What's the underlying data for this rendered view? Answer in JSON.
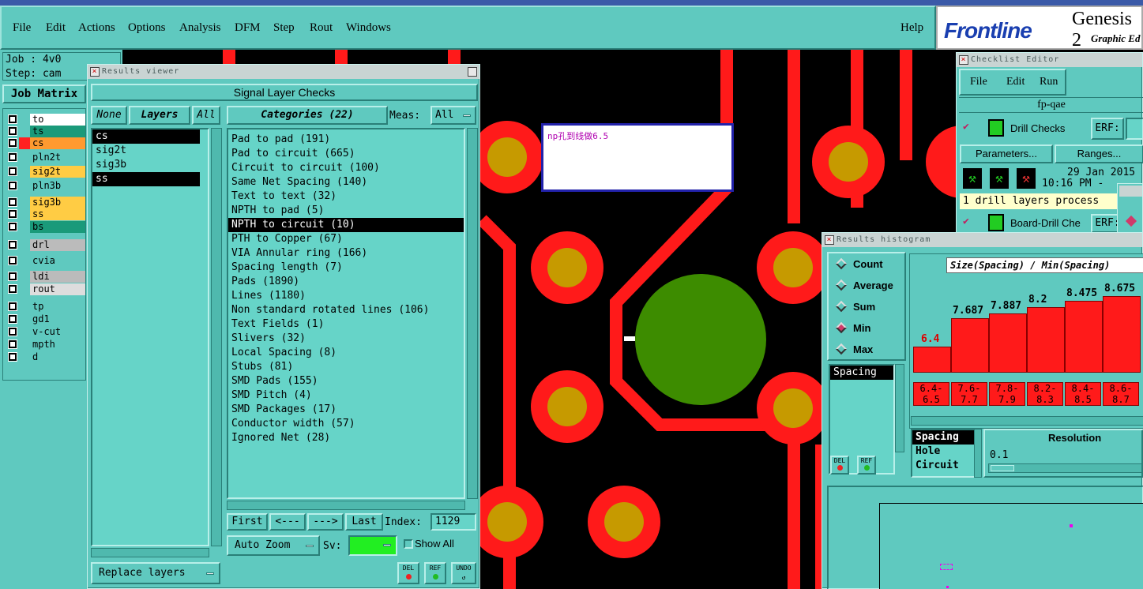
{
  "menu": {
    "file": "File",
    "edit": "Edit",
    "actions": "Actions",
    "options": "Options",
    "analysis": "Analysis",
    "dfm": "DFM",
    "step": "Step",
    "rout": "Rout",
    "windows": "Windows",
    "help": "Help"
  },
  "logo": {
    "brand": "Frontline",
    "product": "Genesis 2",
    "subtitle": "Graphic Ed"
  },
  "job": {
    "job_label": "Job : 4v0",
    "step_label": "Step: cam",
    "matrix_button": "Job Matrix"
  },
  "layers": [
    {
      "name": "to",
      "color": "#ffffff"
    },
    {
      "name": "ts",
      "color": "#1a9a7a"
    },
    {
      "name": "cs",
      "color": "#ff9a30"
    },
    {
      "name": "pln2t",
      "color": "#5fc9bf"
    },
    {
      "name": "sig2t",
      "color": "#ffcc44"
    },
    {
      "name": "pln3b",
      "color": "#5fc9bf"
    },
    {
      "name": "sig3b",
      "color": "#ffcc44"
    },
    {
      "name": "ss",
      "color": "#ffcc44"
    },
    {
      "name": "bs",
      "color": "#1a9a7a"
    },
    {
      "name": "drl",
      "color": "#bbbbbb"
    },
    {
      "name": "cvia",
      "color": "#5fc9bf"
    },
    {
      "name": "ldi",
      "color": "#bbbbbb"
    },
    {
      "name": "rout",
      "color": "#dddddd"
    },
    {
      "name": "tp",
      "color": "#5fc9bf"
    },
    {
      "name": "gd1",
      "color": "#5fc9bf"
    },
    {
      "name": "v-cut",
      "color": "#5fc9bf"
    },
    {
      "name": "mpth",
      "color": "#5fc9bf"
    },
    {
      "name": "d",
      "color": "#5fc9bf"
    }
  ],
  "results_viewer": {
    "title": "Results viewer",
    "header": "Signal Layer Checks",
    "none_btn": "None",
    "layers_btn": "Layers",
    "all_btn": "All",
    "layer_list": [
      "cs",
      "sig2t",
      "sig3b",
      "ss"
    ],
    "categories_btn": "Categories (22)",
    "meas_label": "Meas:",
    "meas_value": "All",
    "categories": [
      "Pad to pad (191)",
      "Pad to circuit (665)",
      "Circuit to circuit (100)",
      "Same Net Spacing (140)",
      "Text to text (32)",
      "NPTH to pad (5)",
      "NPTH to circuit (10)",
      "PTH to Copper (67)",
      "VIA Annular ring (166)",
      "Spacing length (7)",
      "Pads (1890)",
      "Lines (1180)",
      "Non standard rotated lines (106)",
      "Text Fields (1)",
      "Slivers (32)",
      "Local Spacing (8)",
      "Stubs (81)",
      "SMD Pads (155)",
      "SMD Pitch (4)",
      "SMD Packages (17)",
      "Conductor width (57)",
      "Ignored Net (28)"
    ],
    "first": "First",
    "prev": "<---",
    "next": "--->",
    "last": "Last",
    "index_label": "Index:",
    "index_value": "1129",
    "auto_zoom": "Auto Zoom",
    "sv_label": "Sv:",
    "show_all": "Show All",
    "replace_layers": "Replace layers",
    "del": "DEL",
    "ref": "REF",
    "undo": "UNDO"
  },
  "annotation": "np孔到线做6.5",
  "checklist": {
    "title": "Checklist Editor",
    "file": "File",
    "edit": "Edit",
    "run": "Run",
    "name": "fp-qae",
    "drill_checks": "Drill Checks",
    "erf": "ERF:",
    "params": "Parameters...",
    "ranges": "Ranges...",
    "date": "29 Jan 2015",
    "time": "10:16 PM -",
    "status": "1 drill layers process",
    "board_drill": "Board-Drill Che"
  },
  "histogram": {
    "title": "Results histogram",
    "radios": [
      "Count",
      "Average",
      "Sum",
      "Min",
      "Max"
    ],
    "selected_radio": "Min",
    "chart_title": "Size(Spacing) / Min(Spacing)",
    "list1": [
      "Spacing"
    ],
    "list2": [
      "Spacing",
      "Hole",
      "Circuit"
    ],
    "resolution_label": "Resolution",
    "resolution_value": "0.1",
    "del": "DEL",
    "ref": "REF"
  },
  "chart_data": {
    "type": "bar",
    "title": "Size(Spacing) / Min(Spacing)",
    "categories": [
      "6.4-6.5",
      "7.6-7.7",
      "7.8-7.9",
      "8.2-8.3",
      "8.4-8.5",
      "8.6-8.7"
    ],
    "values": [
      6.4,
      7.687,
      7.887,
      8.2,
      8.475,
      8.675
    ],
    "value_labels": [
      "6.4",
      "7.687",
      "7.887",
      "8.2",
      "8.475",
      "8.675"
    ],
    "bin_labels": [
      [
        "6.4-",
        "6.5"
      ],
      [
        "7.6-",
        "7.7"
      ],
      [
        "7.8-",
        "7.9"
      ],
      [
        "8.2-",
        "8.3"
      ],
      [
        "8.4-",
        "8.5"
      ],
      [
        "8.6-",
        "8.7"
      ]
    ]
  },
  "colors": {
    "panel": "#5fc9bf",
    "copper": "#ff1a1a",
    "pad_core": "#c69a00",
    "large_pad": "#3d8c00",
    "canvas": "#000000"
  }
}
